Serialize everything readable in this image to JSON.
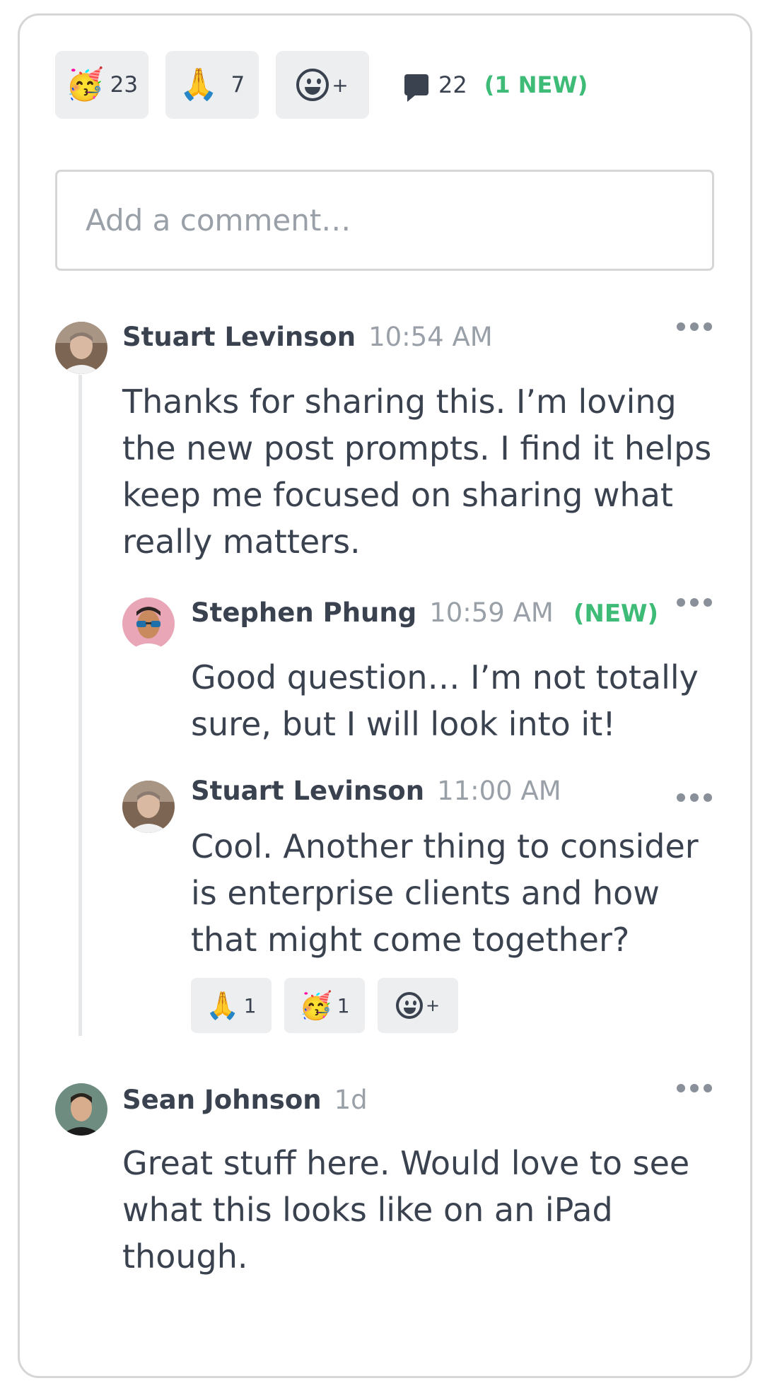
{
  "reactions": [
    {
      "emoji": "🥳",
      "count": "23"
    },
    {
      "emoji": "🙏",
      "count": "7"
    }
  ],
  "add_reaction_label": "+",
  "comment_summary": {
    "count": "22",
    "new_label": "(1 NEW)",
    "icon": "comment-bubble-icon"
  },
  "comment_input": {
    "placeholder": "Add a comment…"
  },
  "comments": [
    {
      "author": "Stuart Levinson",
      "time": "10:54 AM",
      "text": "Thanks for sharing this. I’m loving the new post prompts. I find it helps keep me focused on sharing what really matters.",
      "replies": [
        {
          "author": "Stephen Phung",
          "time": "10:59 AM",
          "new_label": "(NEW)",
          "text": "Good question… I’m not totally sure, but I will look into it!"
        },
        {
          "author": "Stuart Levinson",
          "time": "11:00 AM",
          "text": "Cool. Another thing to consider is enterprise clients and how that might come together?",
          "reactions": [
            {
              "emoji": "🙏",
              "count": "1"
            },
            {
              "emoji": "🥳",
              "count": "1"
            }
          ]
        }
      ]
    },
    {
      "author": "Sean Johnson",
      "time": "1d",
      "text": "Great stuff here. Would love to see what this looks like on an iPad though."
    }
  ],
  "colors": {
    "accent_new": "#3dbb77",
    "text": "#3a4250",
    "muted": "#9aa0a8",
    "chip_bg": "#edeeef",
    "border": "#d6d6d6"
  }
}
